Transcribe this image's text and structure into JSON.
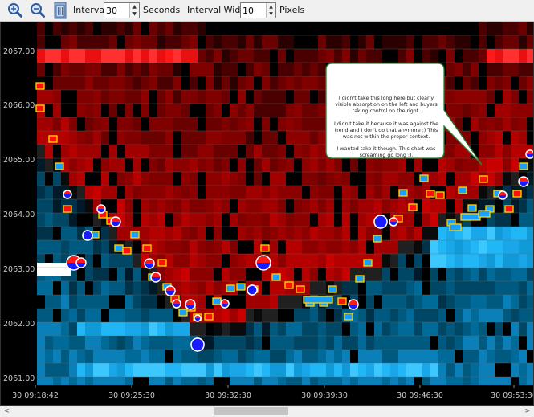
{
  "toolbar": {
    "zoom_in_icon": "zoom-in-magnifier",
    "zoom_out_icon": "zoom-out-magnifier",
    "clear_icon": "trash-can",
    "interval_label": "Interval",
    "interval_value": "30",
    "interval_unit": "Seconds",
    "width_label": "Interval Width",
    "width_value": "10",
    "width_unit": "Pixels"
  },
  "chart": {
    "y_labels": [
      "2067.00",
      "2066.00",
      "2065.00",
      "2064.00",
      "2063.00",
      "2062.00",
      "2061.00"
    ],
    "x_labels": [
      "30 09:18:42",
      "30 09:25:30",
      "30 09:32:30",
      "30 09:39:30",
      "30 09:46:30",
      "30 09:53:30"
    ],
    "callout": [
      "I didn't take this long here but clearly visible absorption on the left and buyers taking control on the right.",
      "I didn't take it because it was against the trend and I don't do that anymore :) This was not within the proper context.",
      "I wanted take it though. This chart was screaming go long :)."
    ]
  },
  "colors": {
    "background": "#000000",
    "ask_red": "#e00000",
    "bid_blue": "#1ea0e6",
    "buy_circle": "#1a1aff",
    "sell_circle": "#ff2020",
    "gridline": "#505050"
  },
  "scrollbar": {
    "left_arrow": "<",
    "right_arrow": ">"
  }
}
